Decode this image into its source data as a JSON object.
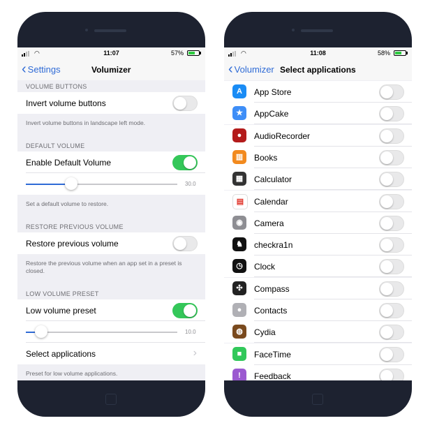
{
  "left": {
    "status": {
      "time": "11:07",
      "battery": "57%"
    },
    "nav": {
      "back_label": "Settings",
      "title": "Volumizer"
    },
    "sections": {
      "volume_buttons": {
        "header": "VOLUME BUTTONS",
        "invert_label": "Invert volume buttons",
        "invert_on": false,
        "footer": "Invert volume buttons in landscape left mode."
      },
      "default_volume": {
        "header": "DEFAULT VOLUME",
        "enable_label": "Enable Default Volume",
        "enable_on": true,
        "slider_value_text": "30.0",
        "slider_fraction": 0.3,
        "footer": "Set a default volume to restore."
      },
      "restore_previous": {
        "header": "RESTORE PREVIOUS VOLUME",
        "restore_label": "Restore previous volume",
        "restore_on": false,
        "footer": "Restore the previous volume when an app set in a preset is closed."
      },
      "low_volume": {
        "header": "LOW VOLUME PRESET",
        "preset_label": "Low volume preset",
        "preset_on": true,
        "slider_value_text": "10.0",
        "slider_fraction": 0.1,
        "select_label": "Select applications",
        "footer": "Preset for low volume applications."
      }
    }
  },
  "right": {
    "status": {
      "time": "11:08",
      "battery": "58%"
    },
    "nav": {
      "back_label": "Volumizer",
      "title": "Select applications"
    },
    "apps": [
      {
        "name": "App Store",
        "icon": "app-store-icon",
        "color": "#1a8cf5",
        "glyph": "A"
      },
      {
        "name": "AppCake",
        "icon": "appcake-icon",
        "color": "#3e8ef7",
        "glyph": "★"
      },
      {
        "name": "AudioRecorder",
        "icon": "audio-recorder-icon",
        "color": "#b31b1b",
        "glyph": "●"
      },
      {
        "name": "Books",
        "icon": "books-icon",
        "color": "#f28a1e",
        "glyph": "▥"
      },
      {
        "name": "Calculator",
        "icon": "calculator-icon",
        "color": "#333333",
        "glyph": "▦"
      },
      {
        "name": "Calendar",
        "icon": "calendar-icon",
        "color": "#ffffff",
        "glyph": "▤"
      },
      {
        "name": "Camera",
        "icon": "camera-icon",
        "color": "#8e8e93",
        "glyph": "◉"
      },
      {
        "name": "checkra1n",
        "icon": "checkra1n-icon",
        "color": "#111111",
        "glyph": "♞"
      },
      {
        "name": "Clock",
        "icon": "clock-icon",
        "color": "#111111",
        "glyph": "◷"
      },
      {
        "name": "Compass",
        "icon": "compass-icon",
        "color": "#222222",
        "glyph": "✣"
      },
      {
        "name": "Contacts",
        "icon": "contacts-icon",
        "color": "#b0b0b5",
        "glyph": "●"
      },
      {
        "name": "Cydia",
        "icon": "cydia-icon",
        "color": "#7a4a1e",
        "glyph": "◍"
      },
      {
        "name": "FaceTime",
        "icon": "facetime-icon",
        "color": "#31c85a",
        "glyph": "■"
      },
      {
        "name": "Feedback",
        "icon": "feedback-icon",
        "color": "#9b59d0",
        "glyph": "!"
      }
    ]
  },
  "colors": {
    "accent": "#2f6bd6",
    "toggle_on": "#34c759",
    "phone_frame": "#1d2230"
  }
}
